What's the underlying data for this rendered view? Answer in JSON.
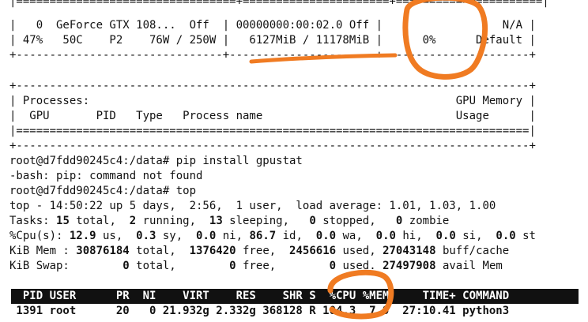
{
  "terminal": {
    "smi_top_fragment": "|=================================+======================+======================|",
    "gpu_row_1": "|   0  GeForce GTX 108...  Off  | 00000000:00:02.0 Off |                  N/A |",
    "gpu_row_2": "| 47%   50C    P2    76W / 250W |   6127MiB / 11178MiB |      0%      Default |",
    "gpu_sep_bottom": "+-------------------------------+----------------------+----------------------+",
    "blank": "",
    "proc_top": "+-----------------------------------------------------------------------------+",
    "proc_title": "| Processes:                                                       GPU Memory |",
    "proc_cols": "|  GPU       PID   Type   Process name                             Usage      |",
    "proc_eq": "|=============================================================================|",
    "prompt_1": "root@d7fdd90245c4:/data# pip install gpustat",
    "error_line": "-bash: pip: command not found",
    "prompt_2": "root@d7fdd90245c4:/data# top",
    "top_summary": "top - 14:50:22 up 5 days,  2:56,  1 user,  load average: 1.01, 1.03, 1.00",
    "tasks": {
      "label": "Tasks: ",
      "total_v": "15",
      "total_l": " total,  ",
      "running_v": "2",
      "running_l": " running,  ",
      "sleeping_v": "13",
      "sleeping_l": " sleeping,   ",
      "stopped_v": "0",
      "stopped_l": " stopped,   ",
      "zombie_v": "0",
      "zombie_l": " zombie"
    },
    "cpu": {
      "label": "%Cpu(s): ",
      "us_v": "12.9",
      "us_l": " us,  ",
      "sy_v": "0.3",
      "sy_l": " sy,  ",
      "ni_v": "0.0",
      "ni_l": " ni, ",
      "id_v": "86.7",
      "id_l": " id,  ",
      "wa_v": "0.0",
      "wa_l": " wa,  ",
      "hi_v": "0.0",
      "hi_l": " hi,  ",
      "si_v": "0.0",
      "si_l": " si,  ",
      "st_v": "0.0",
      "st_l": " st"
    },
    "mem": {
      "label": "KiB Mem : ",
      "total_v": "30876184",
      "total_l": " total,  ",
      "free_v": "1376420",
      "free_l": " free,  ",
      "used_v": "2456616",
      "used_l": " used, ",
      "cache_v": "27043148",
      "cache_l": " buff/cache"
    },
    "swap": {
      "label": "KiB Swap:        ",
      "total_v": "0",
      "total_l": " total,        ",
      "free_v": "0",
      "free_l": " free,        ",
      "used_v": "0",
      "used_l": " used. ",
      "avail_v": "27497908",
      "avail_l": " avail Mem"
    },
    "proc_header": "  PID USER      PR  NI    VIRT    RES    SHR S  %CPU %MEM     TIME+ COMMAND",
    "proc_row": " 1391 root      20   0 21.932g 2.332g 368128 R 104.3  7.9  27:10.41 python3"
  },
  "colors": {
    "background": "#ffffff",
    "text": "#111111",
    "annotation": "#f07b22",
    "header_bg": "#111111",
    "header_text": "#ffffff"
  }
}
